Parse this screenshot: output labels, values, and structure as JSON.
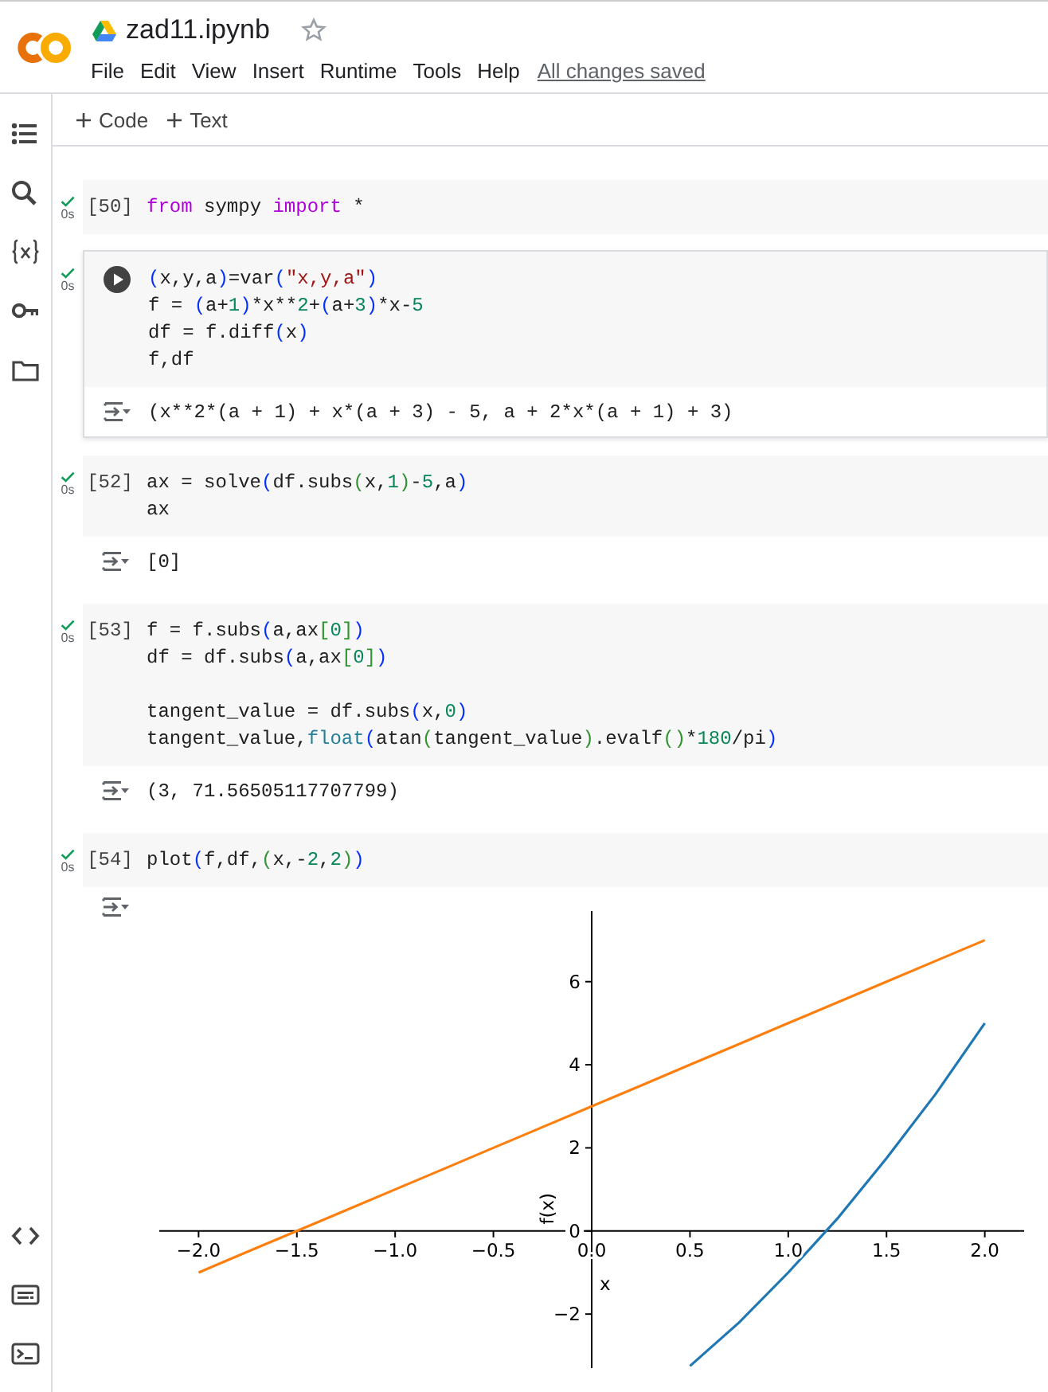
{
  "header": {
    "title": "zad11.ipynb",
    "starred": false,
    "menu": [
      "File",
      "Edit",
      "View",
      "Insert",
      "Runtime",
      "Tools",
      "Help"
    ],
    "save_status": "All changes saved"
  },
  "toolbar": [
    {
      "label": "Code"
    },
    {
      "label": "Text"
    }
  ],
  "cells": [
    {
      "execution_count": "[50]",
      "focused": false,
      "succeeded": true,
      "duration": "0s",
      "code": [
        {
          "segments": [
            {
              "text": "from",
              "kind": "kw"
            },
            {
              "text": " sympy ",
              "kind": "plain"
            },
            {
              "text": "import",
              "kind": "kw"
            },
            {
              "text": " *",
              "kind": "plain"
            }
          ]
        }
      ]
    },
    {
      "focused": true,
      "succeeded": true,
      "duration": "0s",
      "code": [
        {
          "segments": [
            {
              "text": "(",
              "kind": "p1"
            },
            {
              "text": "x,y,a",
              "kind": "plain"
            },
            {
              "text": ")",
              "kind": "p1"
            },
            {
              "text": "=var",
              "kind": "plain"
            },
            {
              "text": "(",
              "kind": "p1"
            },
            {
              "text": "\"x,y,a\"",
              "kind": "str"
            },
            {
              "text": ")",
              "kind": "p1"
            }
          ]
        },
        {
          "segments": [
            {
              "text": "f = ",
              "kind": "plain"
            },
            {
              "text": "(",
              "kind": "p1"
            },
            {
              "text": "a+",
              "kind": "plain"
            },
            {
              "text": "1",
              "kind": "num"
            },
            {
              "text": ")",
              "kind": "p1"
            },
            {
              "text": "*x**",
              "kind": "plain"
            },
            {
              "text": "2",
              "kind": "num"
            },
            {
              "text": "+",
              "kind": "plain"
            },
            {
              "text": "(",
              "kind": "p1"
            },
            {
              "text": "a+",
              "kind": "plain"
            },
            {
              "text": "3",
              "kind": "num"
            },
            {
              "text": ")",
              "kind": "p1"
            },
            {
              "text": "*x-",
              "kind": "plain"
            },
            {
              "text": "5",
              "kind": "num"
            }
          ]
        },
        {
          "segments": [
            {
              "text": "df = f.diff",
              "kind": "plain"
            },
            {
              "text": "(",
              "kind": "p1"
            },
            {
              "text": "x",
              "kind": "plain"
            },
            {
              "text": ")",
              "kind": "p1"
            }
          ]
        },
        {
          "segments": [
            {
              "text": "f,df",
              "kind": "plain"
            }
          ]
        }
      ],
      "output": {
        "kind": "text",
        "text": "(x**2*(a + 1) + x*(a + 3) - 5, a + 2*x*(a + 1) + 3)"
      }
    },
    {
      "execution_count": "[52]",
      "focused": false,
      "succeeded": true,
      "duration": "0s",
      "code": [
        {
          "segments": [
            {
              "text": "ax = solve",
              "kind": "plain"
            },
            {
              "text": "(",
              "kind": "p1"
            },
            {
              "text": "df.subs",
              "kind": "plain"
            },
            {
              "text": "(",
              "kind": "p2"
            },
            {
              "text": "x,",
              "kind": "plain"
            },
            {
              "text": "1",
              "kind": "num"
            },
            {
              "text": ")",
              "kind": "p2"
            },
            {
              "text": "-",
              "kind": "plain"
            },
            {
              "text": "5",
              "kind": "num"
            },
            {
              "text": ",a",
              "kind": "plain"
            },
            {
              "text": ")",
              "kind": "p1"
            }
          ]
        },
        {
          "segments": [
            {
              "text": "ax",
              "kind": "plain"
            }
          ]
        }
      ],
      "output": {
        "kind": "text",
        "text": "[0]"
      }
    },
    {
      "execution_count": "[53]",
      "focused": false,
      "succeeded": true,
      "duration": "0s",
      "code": [
        {
          "segments": [
            {
              "text": "f = f.subs",
              "kind": "plain"
            },
            {
              "text": "(",
              "kind": "p1"
            },
            {
              "text": "a,ax",
              "kind": "plain"
            },
            {
              "text": "[",
              "kind": "p2"
            },
            {
              "text": "0",
              "kind": "num"
            },
            {
              "text": "]",
              "kind": "p2"
            },
            {
              "text": ")",
              "kind": "p1"
            }
          ]
        },
        {
          "segments": [
            {
              "text": "df = df.subs",
              "kind": "plain"
            },
            {
              "text": "(",
              "kind": "p1"
            },
            {
              "text": "a,ax",
              "kind": "plain"
            },
            {
              "text": "[",
              "kind": "p2"
            },
            {
              "text": "0",
              "kind": "num"
            },
            {
              "text": "]",
              "kind": "p2"
            },
            {
              "text": ")",
              "kind": "p1"
            }
          ]
        },
        {
          "blank_before": true,
          "segments": [
            {
              "text": "tangent_value = df.subs",
              "kind": "plain"
            },
            {
              "text": "(",
              "kind": "p1"
            },
            {
              "text": "x,",
              "kind": "plain"
            },
            {
              "text": "0",
              "kind": "num"
            },
            {
              "text": ")",
              "kind": "p1"
            }
          ]
        },
        {
          "segments": [
            {
              "text": "tangent_value,",
              "kind": "plain"
            },
            {
              "text": "float",
              "kind": "fn"
            },
            {
              "text": "(",
              "kind": "p1"
            },
            {
              "text": "atan",
              "kind": "plain"
            },
            {
              "text": "(",
              "kind": "p2"
            },
            {
              "text": "tangent_value",
              "kind": "plain"
            },
            {
              "text": ")",
              "kind": "p2"
            },
            {
              "text": ".evalf",
              "kind": "plain"
            },
            {
              "text": "(",
              "kind": "p2"
            },
            {
              "text": ")",
              "kind": "p2"
            },
            {
              "text": "*",
              "kind": "plain"
            },
            {
              "text": "180",
              "kind": "num"
            },
            {
              "text": "/pi",
              "kind": "plain"
            },
            {
              "text": ")",
              "kind": "p1"
            }
          ]
        }
      ],
      "output": {
        "kind": "text",
        "text": "(3, 71.56505117707799)"
      }
    },
    {
      "execution_count": "[54]",
      "focused": false,
      "succeeded": true,
      "duration": "0s",
      "code": [
        {
          "segments": [
            {
              "text": "plot",
              "kind": "plain"
            },
            {
              "text": "(",
              "kind": "p1"
            },
            {
              "text": "f,df,",
              "kind": "plain"
            },
            {
              "text": "(",
              "kind": "p2"
            },
            {
              "text": "x,-",
              "kind": "plain"
            },
            {
              "text": "2",
              "kind": "num"
            },
            {
              "text": ",",
              "kind": "plain"
            },
            {
              "text": "2",
              "kind": "num"
            },
            {
              "text": ")",
              "kind": "p2"
            },
            {
              "text": ")",
              "kind": "p1"
            }
          ]
        }
      ],
      "output": {
        "kind": "chart",
        "chart_data": {
          "type": "line",
          "xlabel": "x",
          "ylabel": "f(x)",
          "x": [
            -2,
            -1.75,
            -1.5,
            -1.25,
            -1,
            -0.75,
            -0.5,
            -0.25,
            0,
            0.25,
            0.5,
            0.75,
            1,
            1.25,
            1.5,
            1.75,
            2
          ],
          "series": [
            {
              "color": "#1f77b4",
              "values": [
                null,
                null,
                null,
                null,
                null,
                null,
                null,
                null,
                null,
                null,
                -3.25,
                -2.2,
                -1,
                0.3,
                1.75,
                3.3,
                5
              ]
            },
            {
              "color": "#ff7f0e",
              "values": [
                -1,
                -0.5,
                0,
                0.5,
                1,
                1.5,
                2,
                2.5,
                3,
                3.5,
                4,
                4.5,
                5,
                5.5,
                6,
                6.5,
                7
              ]
            }
          ],
          "xlim": [
            -2.2,
            2.2
          ],
          "ylim": [
            -3.3,
            7.7
          ],
          "xticks": [
            {
              "value": -2,
              "label": "−2.0"
            },
            {
              "value": -1.5,
              "label": "−1.5"
            },
            {
              "value": -1,
              "label": "−1.0"
            },
            {
              "value": -0.5,
              "label": "−0.5"
            },
            {
              "value": 0,
              "label": "0.0"
            },
            {
              "value": 0.5,
              "label": "0.5"
            },
            {
              "value": 1,
              "label": "1.0"
            },
            {
              "value": 1.5,
              "label": "1.5"
            },
            {
              "value": 2,
              "label": "2.0"
            }
          ],
          "yticks": [
            {
              "value": -2,
              "label": "−2"
            },
            {
              "value": 0,
              "label": "0"
            },
            {
              "value": 2,
              "label": "2"
            },
            {
              "value": 4,
              "label": "4"
            },
            {
              "value": 6,
              "label": "6"
            }
          ]
        }
      }
    }
  ]
}
